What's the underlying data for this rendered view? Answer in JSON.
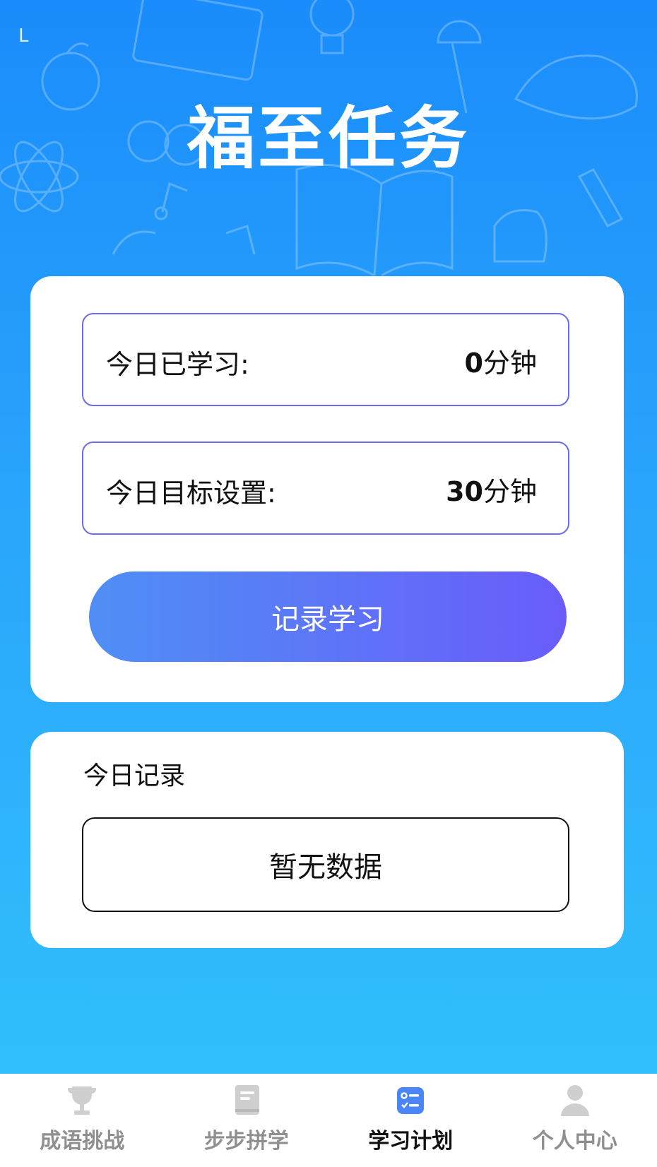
{
  "header": {
    "corner_mark": "L",
    "title": "福至任务"
  },
  "task_card": {
    "studied": {
      "label": "今日已学习:",
      "value": "0",
      "unit": "分钟"
    },
    "goal": {
      "label": "今日目标设置:",
      "value": "30",
      "unit": "分钟"
    },
    "record_button": "记录学习"
  },
  "record_card": {
    "title": "今日记录",
    "empty_text": "暂无数据"
  },
  "tabbar": {
    "active_color": "#4a86f7",
    "items": [
      {
        "label": "成语挑战",
        "icon": "trophy-icon"
      },
      {
        "label": "步步拼学",
        "icon": "book-icon"
      },
      {
        "label": "学习计划",
        "icon": "plan-list-icon"
      },
      {
        "label": "个人中心",
        "icon": "user-icon"
      }
    ],
    "active_index": 2
  }
}
